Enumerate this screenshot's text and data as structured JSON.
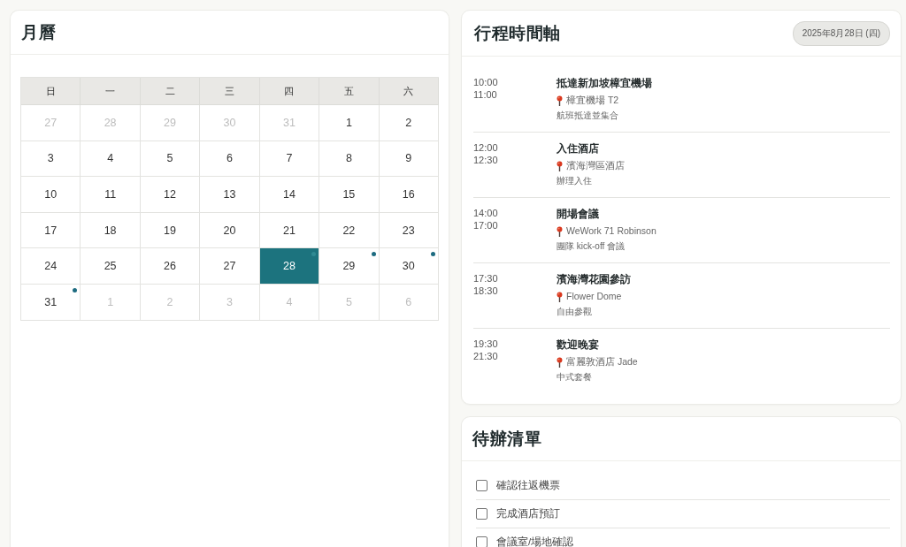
{
  "calendar": {
    "title": "月曆",
    "weekdays": [
      "日",
      "一",
      "二",
      "三",
      "四",
      "五",
      "六"
    ],
    "weeks": [
      [
        {
          "day": "27",
          "other_month": true,
          "selected": false,
          "has_event": false
        },
        {
          "day": "28",
          "other_month": true,
          "selected": false,
          "has_event": false
        },
        {
          "day": "29",
          "other_month": true,
          "selected": false,
          "has_event": false
        },
        {
          "day": "30",
          "other_month": true,
          "selected": false,
          "has_event": false
        },
        {
          "day": "31",
          "other_month": true,
          "selected": false,
          "has_event": false
        },
        {
          "day": "1",
          "other_month": false,
          "selected": false,
          "has_event": false
        },
        {
          "day": "2",
          "other_month": false,
          "selected": false,
          "has_event": false
        }
      ],
      [
        {
          "day": "3",
          "other_month": false,
          "selected": false,
          "has_event": false
        },
        {
          "day": "4",
          "other_month": false,
          "selected": false,
          "has_event": false
        },
        {
          "day": "5",
          "other_month": false,
          "selected": false,
          "has_event": false
        },
        {
          "day": "6",
          "other_month": false,
          "selected": false,
          "has_event": false
        },
        {
          "day": "7",
          "other_month": false,
          "selected": false,
          "has_event": false
        },
        {
          "day": "8",
          "other_month": false,
          "selected": false,
          "has_event": false
        },
        {
          "day": "9",
          "other_month": false,
          "selected": false,
          "has_event": false
        }
      ],
      [
        {
          "day": "10",
          "other_month": false,
          "selected": false,
          "has_event": false
        },
        {
          "day": "11",
          "other_month": false,
          "selected": false,
          "has_event": false
        },
        {
          "day": "12",
          "other_month": false,
          "selected": false,
          "has_event": false
        },
        {
          "day": "13",
          "other_month": false,
          "selected": false,
          "has_event": false
        },
        {
          "day": "14",
          "other_month": false,
          "selected": false,
          "has_event": false
        },
        {
          "day": "15",
          "other_month": false,
          "selected": false,
          "has_event": false
        },
        {
          "day": "16",
          "other_month": false,
          "selected": false,
          "has_event": false
        }
      ],
      [
        {
          "day": "17",
          "other_month": false,
          "selected": false,
          "has_event": false
        },
        {
          "day": "18",
          "other_month": false,
          "selected": false,
          "has_event": false
        },
        {
          "day": "19",
          "other_month": false,
          "selected": false,
          "has_event": false
        },
        {
          "day": "20",
          "other_month": false,
          "selected": false,
          "has_event": false
        },
        {
          "day": "21",
          "other_month": false,
          "selected": false,
          "has_event": false
        },
        {
          "day": "22",
          "other_month": false,
          "selected": false,
          "has_event": false
        },
        {
          "day": "23",
          "other_month": false,
          "selected": false,
          "has_event": false
        }
      ],
      [
        {
          "day": "24",
          "other_month": false,
          "selected": false,
          "has_event": false
        },
        {
          "day": "25",
          "other_month": false,
          "selected": false,
          "has_event": false
        },
        {
          "day": "26",
          "other_month": false,
          "selected": false,
          "has_event": false
        },
        {
          "day": "27",
          "other_month": false,
          "selected": false,
          "has_event": false
        },
        {
          "day": "28",
          "other_month": false,
          "selected": true,
          "has_event": true
        },
        {
          "day": "29",
          "other_month": false,
          "selected": false,
          "has_event": true
        },
        {
          "day": "30",
          "other_month": false,
          "selected": false,
          "has_event": true
        }
      ],
      [
        {
          "day": "31",
          "other_month": false,
          "selected": false,
          "has_event": true
        },
        {
          "day": "1",
          "other_month": true,
          "selected": false,
          "has_event": false
        },
        {
          "day": "2",
          "other_month": true,
          "selected": false,
          "has_event": false
        },
        {
          "day": "3",
          "other_month": true,
          "selected": false,
          "has_event": false
        },
        {
          "day": "4",
          "other_month": true,
          "selected": false,
          "has_event": false
        },
        {
          "day": "5",
          "other_month": true,
          "selected": false,
          "has_event": false
        },
        {
          "day": "6",
          "other_month": true,
          "selected": false,
          "has_event": false
        }
      ]
    ]
  },
  "timeline": {
    "title": "行程時間軸",
    "date_badge": "2025年8月28日 (四)",
    "events": [
      {
        "start": "10:00",
        "end": "11:00",
        "title": "抵達新加坡樟宜機場",
        "location": "樟宜機場 T2",
        "note": "航班抵達並集合"
      },
      {
        "start": "12:00",
        "end": "12:30",
        "title": "入住酒店",
        "location": "濱海灣區酒店",
        "note": "辦理入住"
      },
      {
        "start": "14:00",
        "end": "17:00",
        "title": "開場會議",
        "location": "WeWork 71 Robinson",
        "note": "團隊 kick-off 會議"
      },
      {
        "start": "17:30",
        "end": "18:30",
        "title": "濱海灣花園參訪",
        "location": "Flower Dome",
        "note": "自由參觀"
      },
      {
        "start": "19:30",
        "end": "21:30",
        "title": "歡迎晚宴",
        "location": "富麗敦酒店 Jade",
        "note": "中式套餐"
      }
    ]
  },
  "todo": {
    "title": "待辦清單",
    "items": [
      {
        "label": "確認往返機票",
        "checked": false
      },
      {
        "label": "完成酒店預訂",
        "checked": false
      },
      {
        "label": "會議室/場地確認",
        "checked": false
      }
    ]
  }
}
